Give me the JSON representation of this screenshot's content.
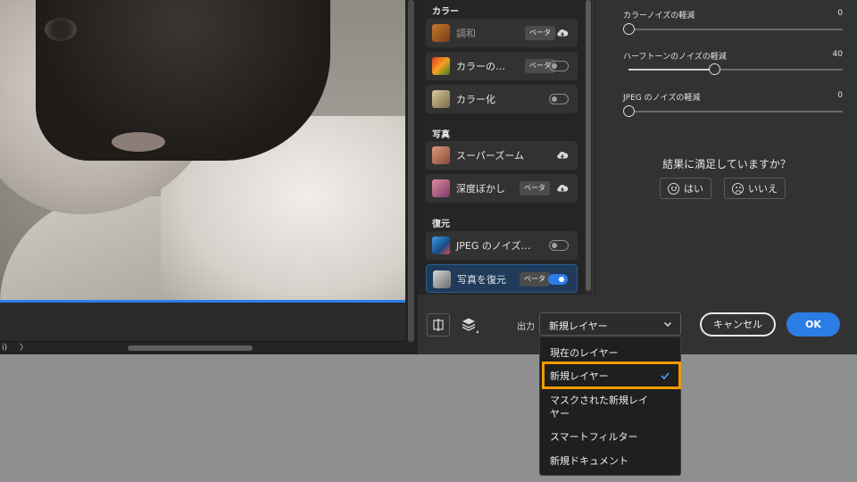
{
  "canvas": {
    "nav_left": "i)",
    "nav_right": "〉"
  },
  "filters": {
    "sections": [
      {
        "label": "カラー"
      },
      {
        "label": "写真"
      },
      {
        "label": "復元"
      }
    ],
    "items": [
      {
        "label": "調和",
        "badge": "ベータ",
        "control": "cloud-download-icon",
        "thumb_icon": "harmony-thumb-icon",
        "dim": true
      },
      {
        "label": "カラーの…",
        "badge": "ベータ",
        "control": "toggle",
        "toggle_on": false,
        "thumb_icon": "color-transfer-thumb-icon"
      },
      {
        "label": "カラー化",
        "control": "toggle",
        "toggle_on": false,
        "thumb_icon": "colorize-thumb-icon"
      },
      {
        "label": "スーパーズーム",
        "control": "cloud-download-icon",
        "thumb_icon": "super-zoom-thumb-icon"
      },
      {
        "label": "深度ぼかし",
        "badge": "ベータ",
        "control": "cloud-download-icon",
        "thumb_icon": "depth-blur-thumb-icon"
      },
      {
        "label": "JPEG のノイズ…",
        "control": "toggle",
        "toggle_on": false,
        "thumb_icon": "jpeg-noise-thumb-icon"
      },
      {
        "label": "写真を復元",
        "badge": "ベータ",
        "control": "toggle",
        "toggle_on": true,
        "selected": true,
        "thumb_icon": "photo-restore-thumb-icon"
      }
    ]
  },
  "settings": {
    "sliders": [
      {
        "label": "カラーノイズの軽減",
        "value": "0",
        "fraction": 0.0
      },
      {
        "label": "ハーフトーンのノイズの軽減",
        "value": "40",
        "fraction": 0.4
      },
      {
        "label": "JPEG のノイズの軽減",
        "value": "0",
        "fraction": 0.0
      }
    ],
    "feedback_question": "結果に満足していますか？",
    "yes_label": "はい",
    "no_label": "いいえ"
  },
  "bottom_bar": {
    "output_label": "出力",
    "output_value": "新規レイヤー",
    "cancel_label": "キャンセル",
    "ok_label": "OK"
  },
  "dropdown": {
    "options": [
      {
        "label": "現在のレイヤー"
      },
      {
        "label": "新規レイヤー",
        "selected": true
      },
      {
        "label": "マスクされた新規レイヤー"
      },
      {
        "label": "スマートフィルター"
      },
      {
        "label": "新規ドキュメント"
      }
    ]
  },
  "colors": {
    "accent": "#2c7ce5",
    "highlight": "#f29a00",
    "panel": "#323232"
  }
}
